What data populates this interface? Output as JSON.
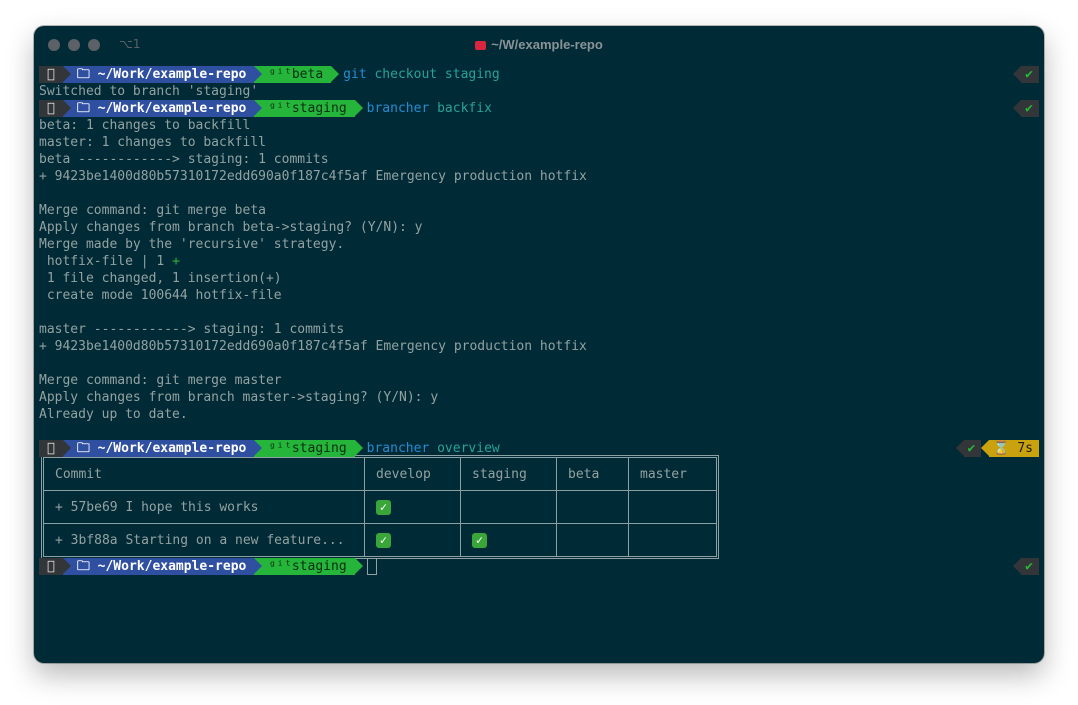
{
  "window": {
    "title": "~/W/example-repo",
    "shortcut": "⌥1"
  },
  "prompt": {
    "os_icon": "apple-icon",
    "path": "~/Work/example-repo",
    "git_icon": "git-icon",
    "ok": "✔"
  },
  "blocks": [
    {
      "branch": "beta",
      "cmd_prog": "git",
      "cmd_args": "checkout staging",
      "output": [
        "Switched to branch 'staging'"
      ]
    },
    {
      "branch": "staging",
      "cmd_prog": "brancher",
      "cmd_args": "backfix",
      "output": [
        "beta: 1 changes to backfill",
        "master: 1 changes to backfill",
        "beta ------------> staging: 1 commits",
        "+ 9423be1400d80b57310172edd690a0f187c4f5af Emergency production hotfix",
        "",
        "Merge command: git merge beta",
        "Apply changes from branch beta->staging? (Y/N): y",
        "Merge made by the 'recursive' strategy.",
        " hotfix-file | 1 ",
        " 1 file changed, 1 insertion(+)",
        " create mode 100644 hotfix-file",
        "",
        "master ------------> staging: 1 commits",
        "+ 9423be1400d80b57310172edd690a0f187c4f5af Emergency production hotfix",
        "",
        "Merge command: git merge master",
        "Apply changes from branch master->staging? (Y/N): y",
        "Already up to date.",
        ""
      ],
      "diffstat_plus": "+"
    },
    {
      "branch": "staging",
      "cmd_prog": "brancher",
      "cmd_args": "overview",
      "elapsed": "7s"
    },
    {
      "branch": "staging"
    }
  ],
  "overview": {
    "headers": [
      "Commit",
      "develop",
      "staging",
      "beta",
      "master"
    ],
    "rows": [
      {
        "commit": "+ 57be69 I hope this works",
        "marks": [
          true,
          false,
          false,
          false
        ]
      },
      {
        "commit": "+ 3bf88a Starting on a new feature...",
        "marks": [
          true,
          true,
          false,
          false
        ]
      }
    ],
    "check": "✓"
  },
  "colors": {
    "background": "#002b36",
    "path_segment": "#2f4fa0",
    "git_segment": "#25b53a",
    "command": "#268bd2",
    "argument": "#2aa198",
    "timer": "#c9a20e"
  }
}
